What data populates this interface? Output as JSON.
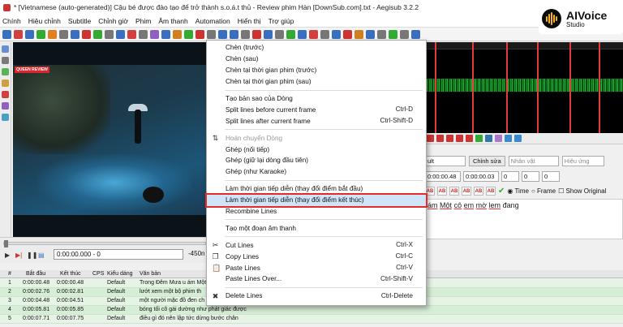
{
  "window": {
    "title": "* [Vietnamese (auto-generated)] Cậu bé được đào tạo để trở thành s.o.á.t thủ - Review phim Hàn [DownSub.com].txt - Aegisub 3.2.2"
  },
  "menu": [
    "Chính",
    "Hiệu chỉnh",
    "Subtitle",
    "Chỉnh giờ",
    "Phim",
    "Âm thanh",
    "Automation",
    "Hiển thị",
    "Trợ giúp"
  ],
  "logo": {
    "name": "AIVoice",
    "sub": "Studio"
  },
  "video": {
    "badge": "QUEEN REVIEW",
    "timecode": "0:00:00.000 - 0",
    "offset": "-450n"
  },
  "edit_panel": {
    "style": "ult",
    "edit_button": "Chỉnh sửa",
    "actor_placeholder": "Nhân vật",
    "effect_placeholder": "Hiệu ứng",
    "start_time": "0:00:00.48",
    "duration": "0:00:00.03",
    "margin_l": "0",
    "margin_r": "0",
    "margin_v": "0",
    "style_buttons": [
      "AB",
      "AB",
      "AB",
      "AB",
      "AB",
      "AB"
    ],
    "radio_time": "Time",
    "radio_frame": "Frame",
    "show_original": "Show Original",
    "text_words": [
      "ám",
      "Một",
      "cô",
      "em",
      "mờ",
      "lem",
      "đang"
    ]
  },
  "grid": {
    "headers": [
      "#",
      "Bắt đầu",
      "Kết thúc",
      "CPS",
      "Kiểu dáng",
      "Văn bản"
    ],
    "rows": [
      {
        "n": "1",
        "start": "0:00:00.48",
        "end": "0:00:00.48",
        "style": "Default",
        "text": "Trong Đêm Mưa u ám Một"
      },
      {
        "n": "2",
        "start": "0:00:02.76",
        "end": "0:00:02.81",
        "style": "Default",
        "text": "lướt xem một bộ phim th"
      },
      {
        "n": "3",
        "start": "0:00:04.48",
        "end": "0:00:04.51",
        "style": "Default",
        "text": "một người mặc đồ đen ch"
      },
      {
        "n": "4",
        "start": "0:00:05.81",
        "end": "0:00:05.85",
        "style": "Default",
        "text": "bóng tối cô gái dường như phát giác được"
      },
      {
        "n": "5",
        "start": "0:00:07.71",
        "end": "0:00:07.75",
        "style": "Default",
        "text": "điều gì đó nên lập tức dừng bước chân"
      }
    ]
  },
  "context_menu": {
    "items": [
      {
        "label": "Chèn (trước)",
        "shortcut": "",
        "icon": "",
        "disabled": false
      },
      {
        "label": "Chèn (sau)",
        "shortcut": "",
        "icon": "",
        "disabled": false
      },
      {
        "label": "Chèn tại thời gian phim (trước)",
        "shortcut": "",
        "icon": "",
        "disabled": false
      },
      {
        "label": "Chèn tại thời gian phim (sau)",
        "shortcut": "",
        "icon": "",
        "disabled": false
      },
      {
        "sep": true
      },
      {
        "label": "Tạo bản sao của Dòng",
        "shortcut": "",
        "icon": "",
        "disabled": false
      },
      {
        "label": "Split lines before current frame",
        "shortcut": "Ctrl-D",
        "icon": "",
        "disabled": false
      },
      {
        "label": "Split lines after current frame",
        "shortcut": "Ctrl-Shift-D",
        "icon": "",
        "disabled": false
      },
      {
        "sep": true
      },
      {
        "label": "Hoán chuyển Dòng",
        "shortcut": "",
        "icon": "swap-icon",
        "disabled": true
      },
      {
        "label": "Ghép (nối tiếp)",
        "shortcut": "",
        "icon": "",
        "disabled": false
      },
      {
        "label": "Ghép (giữ lại dòng đầu tiên)",
        "shortcut": "",
        "icon": "",
        "disabled": false
      },
      {
        "label": "Ghép (như Karaoke)",
        "shortcut": "",
        "icon": "",
        "disabled": false
      },
      {
        "sep": true
      },
      {
        "label": "Làm thời gian tiếp diễn (thay đổi điểm bắt đầu)",
        "shortcut": "",
        "icon": "",
        "disabled": false
      },
      {
        "label": "Làm thời gian tiếp diễn (thay đổi điểm kết thúc)",
        "shortcut": "",
        "icon": "",
        "disabled": false,
        "highlight": true
      },
      {
        "label": "Recombine Lines",
        "shortcut": "",
        "icon": "",
        "disabled": false
      },
      {
        "sep": true
      },
      {
        "label": "Tạo một đoạn âm thanh",
        "shortcut": "",
        "icon": "",
        "disabled": false
      },
      {
        "sep": true
      },
      {
        "label": "Cut Lines",
        "shortcut": "Ctrl-X",
        "icon": "cut-icon",
        "disabled": false
      },
      {
        "label": "Copy Lines",
        "shortcut": "Ctrl-C",
        "icon": "copy-icon",
        "disabled": false
      },
      {
        "label": "Paste Lines",
        "shortcut": "Ctrl-V",
        "icon": "paste-icon",
        "disabled": false
      },
      {
        "label": "Paste Lines Over...",
        "shortcut": "Ctrl-Shift-V",
        "icon": "",
        "disabled": false
      },
      {
        "sep": true
      },
      {
        "label": "Delete Lines",
        "shortcut": "Ctrl-Delete",
        "icon": "delete-icon",
        "disabled": false
      }
    ]
  }
}
